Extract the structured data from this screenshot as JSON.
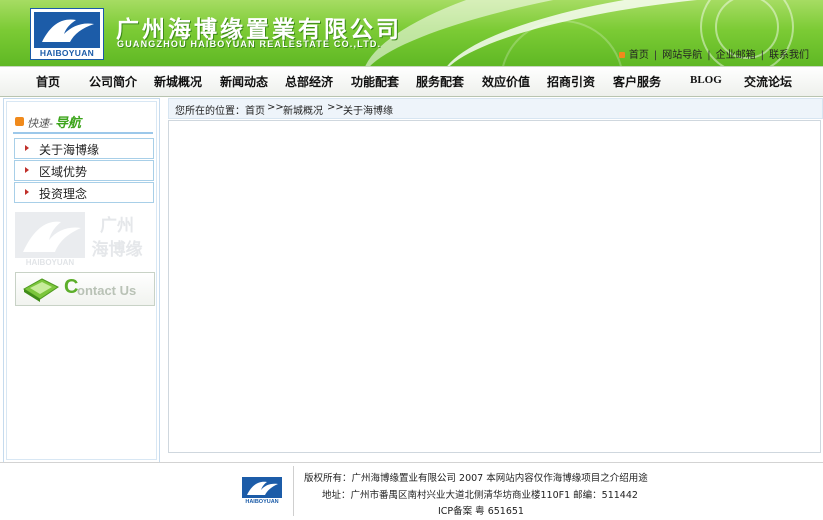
{
  "header": {
    "logo_text": "HAIBOYUAN",
    "company_cn": "广州海博缘置業有限公司",
    "company_en": "GUANGZHOU HAIBOYUAN REALESTATE CO.,LTD.",
    "top_links": [
      "首页",
      "网站导航",
      "企业邮箱",
      "联系我们"
    ],
    "accent_color": "#7ccb35"
  },
  "nav": {
    "items": [
      "首页",
      "公司简介",
      "新城概况",
      "新闻动态",
      "总部经济",
      "功能配套",
      "服务配套",
      "效应价值",
      "招商引资",
      "客户服务",
      "BLOG",
      "交流论坛"
    ]
  },
  "sidebar": {
    "title_prefix": "快速-",
    "title_main": "导航",
    "items": [
      "关于海博缘",
      "区域优势",
      "投资理念"
    ],
    "watermark_logo_text": "HAIBOYUAN",
    "watermark_text_line1": "广州",
    "watermark_text_line2": "海博缘",
    "contact_c": "C",
    "contact_rest": "ontact Us"
  },
  "breadcrumb": {
    "prefix": "您所在的位置：首页",
    "sep1": ">>",
    "level1": "新城概况",
    "sep2": ">>",
    "level2": "关于海博缘"
  },
  "footer": {
    "logo_text": "HAIBOYUAN",
    "copyright": "版权所有：广州海博缘置业有限公司 2007 本网站内容仅作海博缘项目之介绍用途",
    "address": "地址：广州市番禺区南村兴业大道北侧清华坊商业楼110F1 邮编：511442",
    "icp": "ICP备案 粤 651651"
  }
}
